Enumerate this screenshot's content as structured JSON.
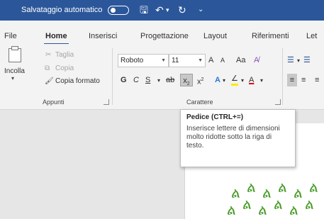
{
  "titlebar": {
    "autosave_label": "Salvataggio automatico"
  },
  "tabs": [
    {
      "label": "File"
    },
    {
      "label": "Home"
    },
    {
      "label": "Inserisci"
    },
    {
      "label": "Progettazione"
    },
    {
      "label": "Layout"
    },
    {
      "label": "Riferimenti"
    },
    {
      "label": "Let"
    }
  ],
  "clipboard": {
    "paste_label": "Incolla",
    "cut_label": "Taglia",
    "copy_label": "Copia",
    "format_painter_label": "Copia formato",
    "group_label": "Appunti"
  },
  "font": {
    "font_name": "Roboto",
    "font_size": "11",
    "grow_label": "A",
    "shrink_label": "A",
    "case_label": "Aa",
    "bold_label": "G",
    "italic_label": "C",
    "underline_label": "S",
    "strike_label": "ab",
    "subscript_label": "x",
    "superscript_label": "x",
    "effects_label": "A",
    "highlight_label": "∠",
    "font_color_label": "A",
    "group_label": "Carattere"
  },
  "tooltip": {
    "title": "Pedice (CTRL+=)",
    "description": "Inserisce lettere di dimensioni molto ridotte sotto la riga di testo."
  },
  "colors": {
    "titlebar": "#2b579a",
    "ribbon": "#f3f3f3",
    "pattern_green": "#4a9d2a"
  }
}
